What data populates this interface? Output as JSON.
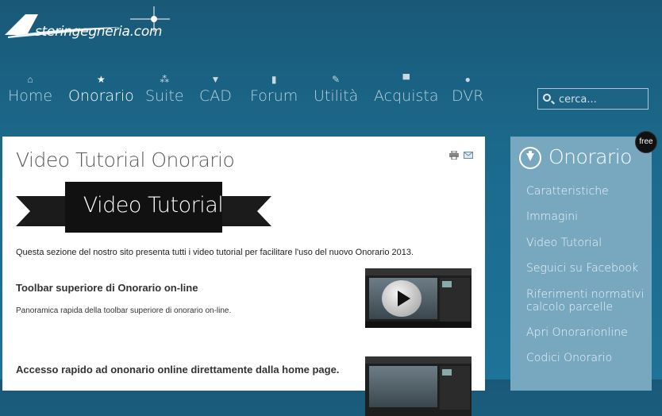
{
  "logo": {
    "text": "steringegneria.com"
  },
  "nav": [
    {
      "icon": "home-icon",
      "label": "Home"
    },
    {
      "icon": "star-icon",
      "label": "Onorario"
    },
    {
      "icon": "bubbles-icon",
      "label": "Suite"
    },
    {
      "icon": "caret-down-icon",
      "label": "CAD"
    },
    {
      "icon": "book-icon",
      "label": "Forum"
    },
    {
      "icon": "wrench-icon",
      "label": "Utilità"
    },
    {
      "icon": "cart-icon",
      "label": "Acquista"
    },
    {
      "icon": "disc-icon",
      "label": "DVR"
    }
  ],
  "search": {
    "placeholder": "cerca..."
  },
  "main": {
    "title": "Video Tutorial Onorario",
    "banner": "Video Tutorial",
    "intro": "Questa sezione del nostro sito presenta tutti i video tutorial per facilitare l'uso del nuovo Onorario 2013.",
    "videos": [
      {
        "title": "Toolbar superiore di Onorario on-line",
        "desc": "Panoramica rapida della toolbar superiore di onorario on-line."
      },
      {
        "title": "Accesso rapido ad ononario online direttamente dalla home page.",
        "desc": ""
      }
    ]
  },
  "sidebar": {
    "badge": "free",
    "title": "Onorario",
    "links": [
      "Caratteristiche",
      "Immagini",
      "Video Tutorial",
      "Seguici su Facebook",
      "Riferimenti normativi calcolo parcelle",
      "Apri Onorarionline",
      "Codici Onorario"
    ]
  }
}
